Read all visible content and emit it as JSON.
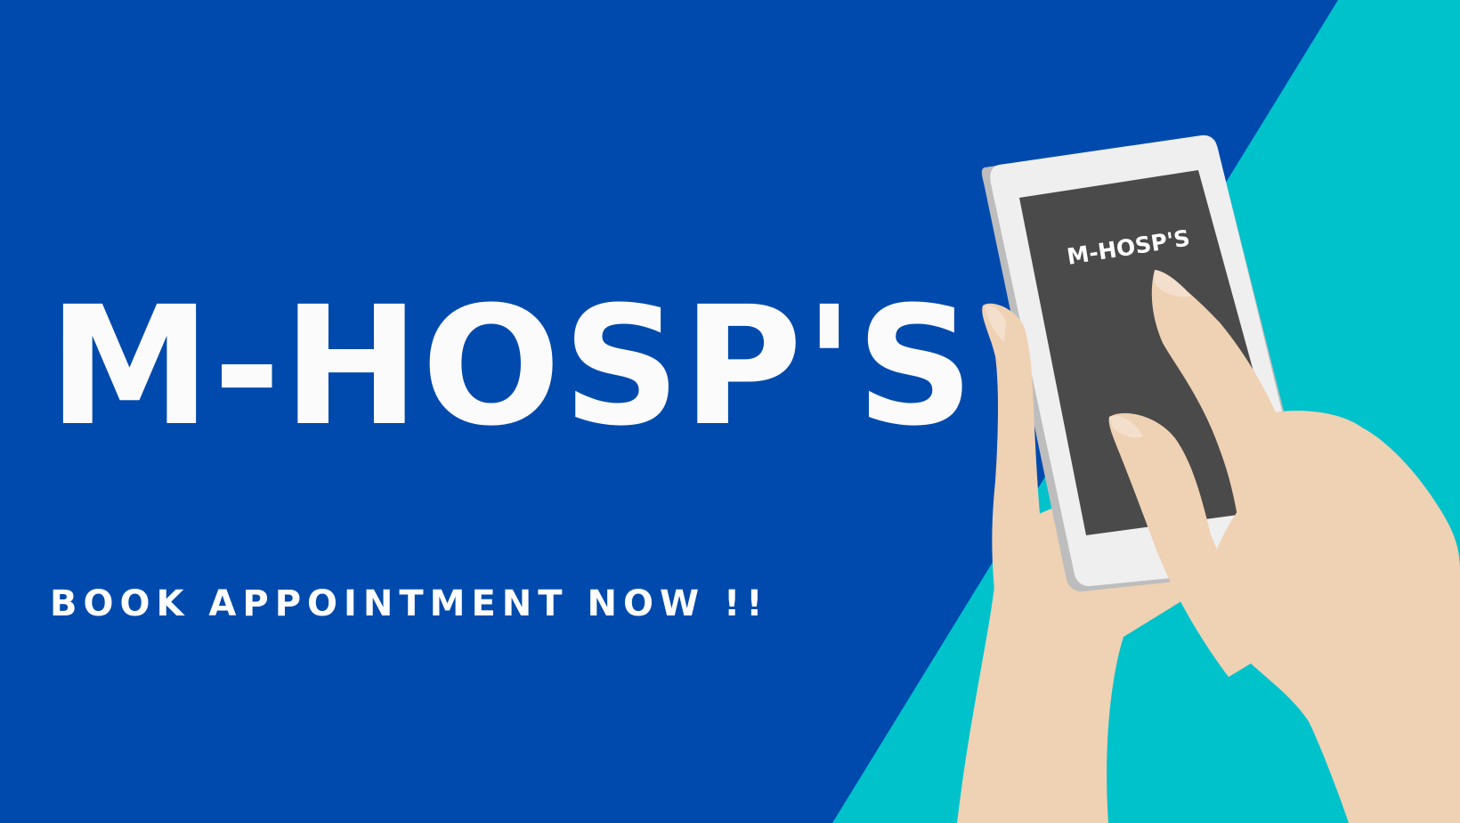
{
  "brand": {
    "title": "M-HOSP'S",
    "tagline": "BOOK APPOINTMENT NOW !!",
    "phone_screen_title": "M-HOSP'S"
  },
  "colors": {
    "background_blue": "#004aad",
    "accent_cyan": "#00c2cb",
    "text_white": "#ffffff",
    "phone_body": "#efefef",
    "phone_screen": "#4a4a4a",
    "skin": "#efd1b4"
  },
  "illustration": {
    "subject": "hand-holding-smartphone-icon"
  }
}
